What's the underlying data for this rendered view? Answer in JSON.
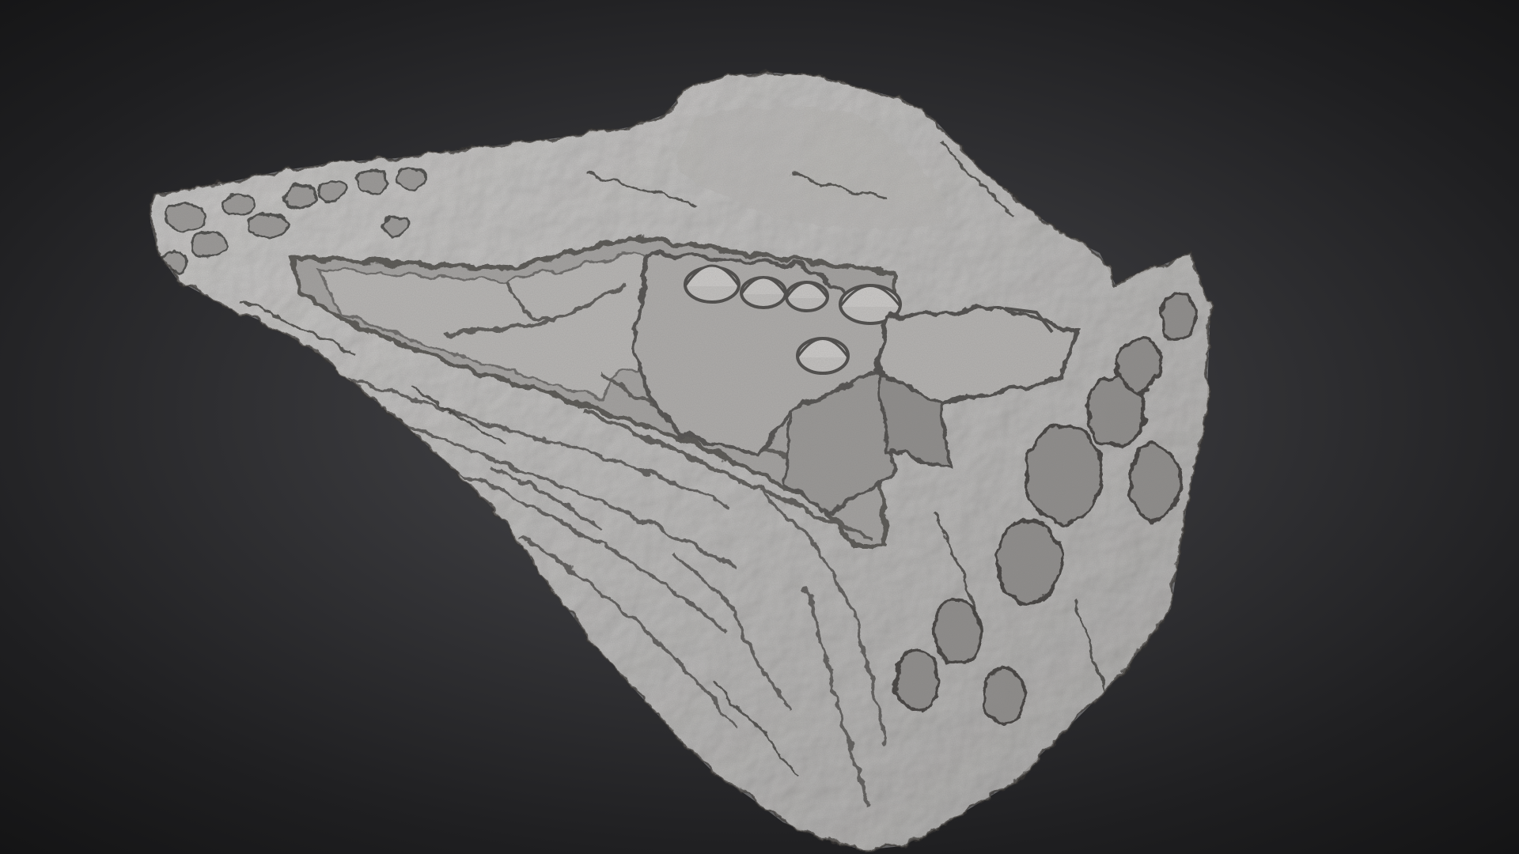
{
  "viewer": {
    "view": "3d-model-viewport",
    "model": "photogrammetry-terrain-mesh",
    "material": "untextured-clay",
    "colors": {
      "background_center": "#4a4a4d",
      "background_edge": "#141415",
      "mesh_base": "#a8a6a5",
      "mesh_light": "#c9c7c5",
      "mesh_shadow": "#4d4b4a"
    },
    "visible_ui_text": []
  }
}
